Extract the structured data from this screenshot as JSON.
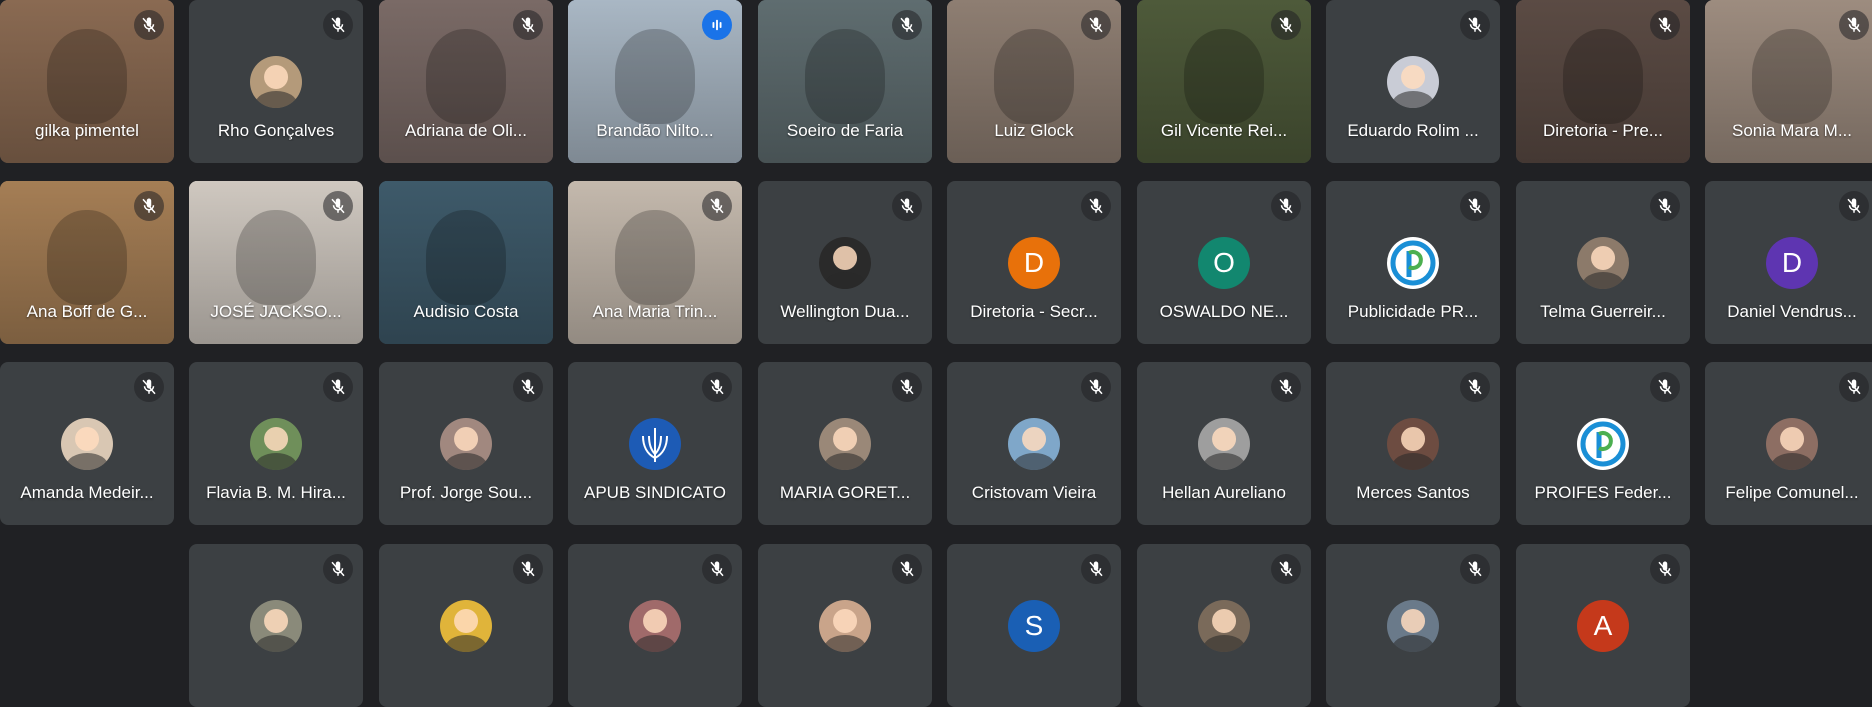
{
  "participants": [
    {
      "name": "gilka pimentel",
      "type": "video",
      "bg": "#8a6a52",
      "muted": true
    },
    {
      "name": "Rho Gonçalves",
      "type": "photo",
      "bg": "#b49a7a",
      "muted": true
    },
    {
      "name": "Adriana de Oli...",
      "type": "video",
      "bg": "#7a6a66",
      "muted": true
    },
    {
      "name": "Brandão Nilto...",
      "type": "video",
      "bg": "#a9b7c4",
      "muted": false,
      "speaking": true
    },
    {
      "name": "Soeiro de Faria",
      "type": "video",
      "bg": "#5f6d70",
      "muted": true
    },
    {
      "name": "Luiz Glock",
      "type": "video",
      "bg": "#8e7e72",
      "muted": true
    },
    {
      "name": "Gil Vicente Rei...",
      "type": "video",
      "bg": "#4e5a3a",
      "muted": true
    },
    {
      "name": "Eduardo Rolim ...",
      "type": "photo",
      "bg": "#c9ccd6",
      "muted": true
    },
    {
      "name": "Diretoria - Pre...",
      "type": "video",
      "bg": "#5b4b44",
      "muted": true
    },
    {
      "name": "Sonia Mara M...",
      "type": "video",
      "bg": "#9d8c7f",
      "muted": true
    },
    {
      "name": "Ana Boff de G...",
      "type": "video",
      "bg": "#a57e55",
      "muted": true
    },
    {
      "name": "JOSÉ JACKSO...",
      "type": "video",
      "bg": "#cfc8c0",
      "muted": true
    },
    {
      "name": "Audisio Costa",
      "type": "video",
      "bg": "#3e5a6a",
      "muted": false
    },
    {
      "name": "Ana Maria Trin...",
      "type": "video",
      "bg": "#c4b9ad",
      "muted": true
    },
    {
      "name": "Wellington Dua...",
      "type": "photo",
      "bg": "#2a2a2a",
      "muted": true
    },
    {
      "name": "Diretoria - Secr...",
      "type": "letter",
      "letter": "D",
      "bg": "#e8710a",
      "muted": true
    },
    {
      "name": "OSWALDO NE...",
      "type": "letter",
      "letter": "O",
      "bg": "#12876f",
      "muted": true
    },
    {
      "name": "Publicidade PR...",
      "type": "logo",
      "bg": "#ffffff",
      "muted": true
    },
    {
      "name": "Telma Guerreir...",
      "type": "photo",
      "bg": "#8c7a6a",
      "muted": true
    },
    {
      "name": "Daniel Vendrus...",
      "type": "letter",
      "letter": "D",
      "bg": "#5e35b1",
      "muted": true
    },
    {
      "name": "Amanda Medeir...",
      "type": "photo",
      "bg": "#d9c7b3",
      "muted": true
    },
    {
      "name": "Flavia B. M. Hira...",
      "type": "photo",
      "bg": "#6f8f5a",
      "muted": true
    },
    {
      "name": "Prof. Jorge Sou...",
      "type": "photo",
      "bg": "#a1887f",
      "muted": true
    },
    {
      "name": "APUB SINDICATO",
      "type": "logo2",
      "bg": "#1d5bb5",
      "muted": true
    },
    {
      "name": "MARIA GORET...",
      "type": "photo",
      "bg": "#9a8878",
      "muted": true
    },
    {
      "name": "Cristovam Vieira",
      "type": "photo",
      "bg": "#7fa7c9",
      "muted": true
    },
    {
      "name": "Hellan Aureliano",
      "type": "photo",
      "bg": "#9e9e9e",
      "muted": true
    },
    {
      "name": "Merces Santos",
      "type": "photo",
      "bg": "#6d4c41",
      "muted": true
    },
    {
      "name": "PROIFES Feder...",
      "type": "logo",
      "bg": "#ffffff",
      "muted": true
    },
    {
      "name": "Felipe Comunel...",
      "type": "photo",
      "bg": "#8d6e63",
      "muted": true
    },
    {
      "name": "",
      "type": "photo",
      "bg": "#8a8a7a",
      "muted": true
    },
    {
      "name": "",
      "type": "photo",
      "bg": "#e0b43a",
      "muted": true
    },
    {
      "name": "",
      "type": "photo",
      "bg": "#a06a6a",
      "muted": true
    },
    {
      "name": "",
      "type": "photo",
      "bg": "#c9a48a",
      "muted": true
    },
    {
      "name": "",
      "type": "letter",
      "letter": "S",
      "bg": "#1a5fb4",
      "muted": true
    },
    {
      "name": "",
      "type": "photo",
      "bg": "#7a6a5a",
      "muted": true
    },
    {
      "name": "",
      "type": "photo",
      "bg": "#6a7a8a",
      "muted": true
    },
    {
      "name": "",
      "type": "letter",
      "letter": "A",
      "bg": "#c5391b",
      "muted": true
    }
  ]
}
